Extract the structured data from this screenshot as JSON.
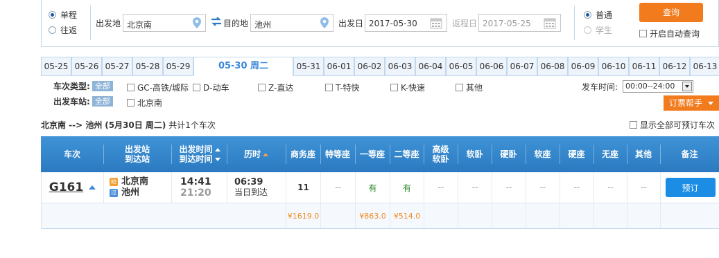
{
  "search": {
    "trip_types": [
      {
        "label": "单程",
        "selected": true
      },
      {
        "label": "往返",
        "selected": false
      }
    ],
    "from_label": "出发地",
    "from_value": "北京南",
    "to_label": "目的地",
    "to_value": "池州",
    "depart_label": "出发日",
    "depart_value": "2017-05-30",
    "return_label": "返程日",
    "return_value": "2017-05-25",
    "passenger_types": [
      {
        "label": "普通",
        "selected": true
      },
      {
        "label": "学生",
        "selected": false
      }
    ],
    "query_button": "查询",
    "auto_query_label": "开启自动查询"
  },
  "date_tabs": [
    "05-25",
    "05-26",
    "05-27",
    "05-28",
    "05-29",
    "05-30 周二",
    "05-31",
    "06-01",
    "06-02",
    "06-03",
    "06-04",
    "06-05",
    "06-06",
    "06-07",
    "06-08",
    "06-09",
    "06-10",
    "06-11",
    "06-12",
    "06-13"
  ],
  "selected_date_index": 5,
  "filters": {
    "train_type_label": "车次类型:",
    "train_type_all": "全部",
    "train_types": [
      "GC-高铁/城际",
      "D-动车",
      "Z-直达",
      "T-特快",
      "K-快速",
      "其他"
    ],
    "station_label": "出发车站:",
    "station_all": "全部",
    "stations": [
      "北京南"
    ],
    "depart_time_label": "发车时间:",
    "depart_time_value": "00:00--24:00",
    "help_button": "订票帮手"
  },
  "summary": {
    "route": "北京南 --> 池州",
    "date": "(5月30日 周二)",
    "count_text": "共计1个车次",
    "show_all_label": "显示全部可预订车次"
  },
  "table": {
    "headers": {
      "train": "车次",
      "station_from": "出发站",
      "station_to": "到达站",
      "time_depart": "出发时间",
      "time_arrive": "到达时间",
      "duration": "历时",
      "business": "商务座",
      "special": "特等座",
      "first": "一等座",
      "second": "二等座",
      "premium_sleeper_1": "高级",
      "premium_sleeper_2": "软卧",
      "soft_sleeper": "软卧",
      "hard_sleeper": "硬卧",
      "soft_seat": "软座",
      "hard_seat": "硬座",
      "no_seat": "无座",
      "other": "其他",
      "remark": "备注"
    },
    "rows": [
      {
        "train_no": "G161",
        "from_badge": "始",
        "from_station": "北京南",
        "to_badge": "过",
        "to_station": "池州",
        "depart_time": "14:41",
        "arrive_time": "21:20",
        "duration": "06:39",
        "arrive_day": "当日到达",
        "business": "11",
        "special": "--",
        "first": "有",
        "second": "有",
        "premium_sleeper": "--",
        "soft_sleeper": "--",
        "hard_sleeper": "--",
        "soft_seat": "--",
        "hard_seat": "--",
        "no_seat": "--",
        "other": "--",
        "book_button": "预订",
        "prices": {
          "business": "¥1619.0",
          "first": "¥863.0",
          "second": "¥514.0"
        }
      }
    ]
  },
  "colors": {
    "accent_orange": "#f27b1e",
    "header_blue": "#2b7ac1",
    "book_blue": "#1c8de5",
    "available_green": "#2d8a2d",
    "price_orange": "#f08a24"
  }
}
